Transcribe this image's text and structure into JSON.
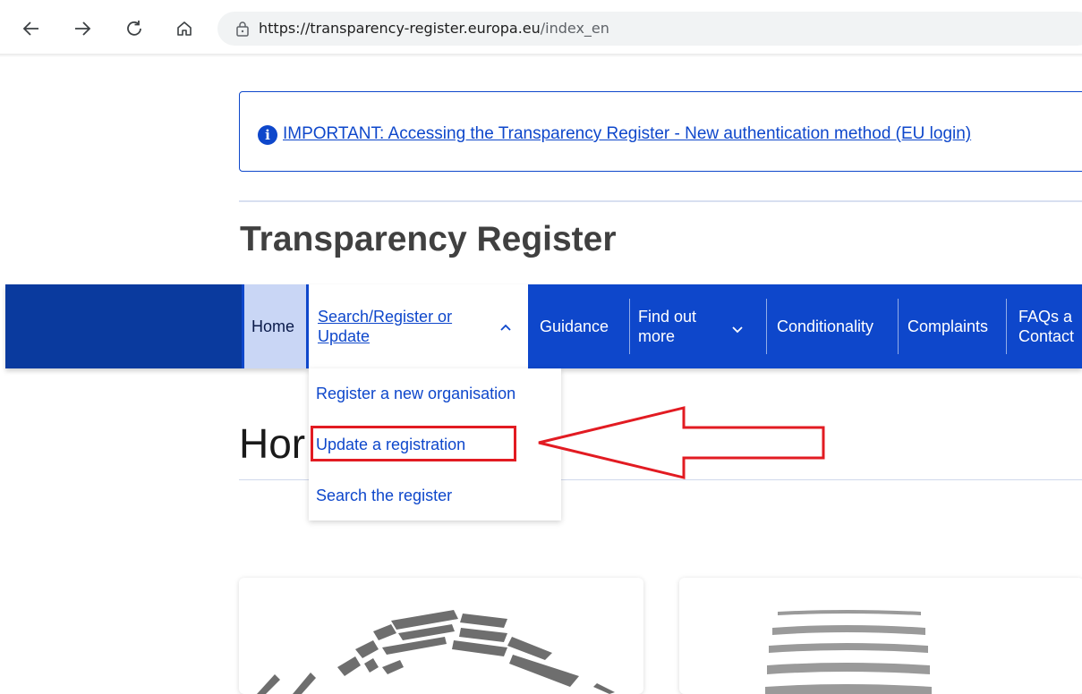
{
  "browser": {
    "url_host": "https://transparency-register.europa.eu",
    "url_path": "/index_en"
  },
  "notice": {
    "link_text": "IMPORTANT: Accessing the Transparency Register - New authentication method (EU login)"
  },
  "site": {
    "title": "Transparency Register"
  },
  "nav": {
    "home": "Home",
    "search_line1": "Search/Register or",
    "search_line2": "Update",
    "guidance": "Guidance",
    "find_line1": "Find out",
    "find_line2": "more",
    "conditionality": "Conditionality",
    "complaints": "Complaints",
    "faqs_line1": "FAQs a",
    "faqs_line2": "Contact"
  },
  "dropdown": {
    "items": [
      "Register a new organisation",
      "Update a registration",
      "Search the register"
    ]
  },
  "page": {
    "heading_partial": "Hor"
  },
  "colors": {
    "brand_blue": "#0e47cb",
    "annotation_red": "#e21b22"
  }
}
